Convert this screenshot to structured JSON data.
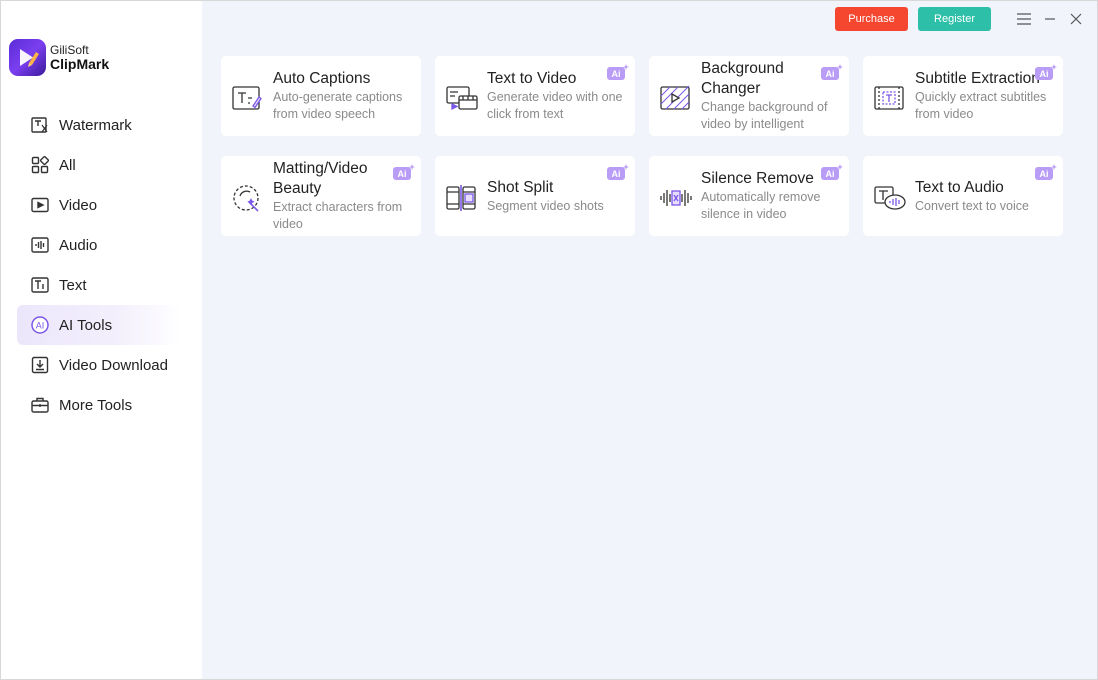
{
  "app": {
    "brand": "GiliSoft",
    "product": "ClipMark"
  },
  "topbar": {
    "purchase_label": "Purchase",
    "register_label": "Register"
  },
  "sidebar": {
    "items": [
      {
        "label": "Watermark",
        "icon": "watermark-icon",
        "active": false
      },
      {
        "label": "All",
        "icon": "grid-icon",
        "active": false
      },
      {
        "label": "Video",
        "icon": "video-icon",
        "active": false
      },
      {
        "label": "Audio",
        "icon": "audio-icon",
        "active": false
      },
      {
        "label": "Text",
        "icon": "text-icon",
        "active": false
      },
      {
        "label": "AI Tools",
        "icon": "ai-icon",
        "active": true
      },
      {
        "label": "Video Download",
        "icon": "download-icon",
        "active": false
      },
      {
        "label": "More Tools",
        "icon": "toolbox-icon",
        "active": false
      }
    ]
  },
  "tools": [
    {
      "title": "Auto Captions",
      "desc": "Auto-generate captions from video speech",
      "ai": false,
      "icon": "auto-captions-icon"
    },
    {
      "title": "Text to Video",
      "desc": "Generate video with one click from text",
      "ai": true,
      "icon": "text-to-video-icon"
    },
    {
      "title": "Background Changer",
      "desc": "Change background of video by intelligent",
      "ai": true,
      "icon": "background-changer-icon"
    },
    {
      "title": "Subtitle Extraction",
      "desc": "Quickly extract subtitles from video",
      "ai": true,
      "icon": "subtitle-extraction-icon"
    },
    {
      "title": "Matting/Video Beauty",
      "desc": "Extract characters from video",
      "ai": true,
      "icon": "matting-icon"
    },
    {
      "title": "Shot Split",
      "desc": "Segment video shots",
      "ai": true,
      "icon": "shot-split-icon"
    },
    {
      "title": "Silence Remove",
      "desc": "Automatically remove silence in video",
      "ai": true,
      "icon": "silence-remove-icon"
    },
    {
      "title": "Text to Audio",
      "desc": "Convert text to voice",
      "ai": true,
      "icon": "text-to-audio-icon"
    }
  ],
  "colors": {
    "accent": "#7b57e8",
    "purchase": "#f5462f",
    "register": "#2ebfa8",
    "main_bg": "#f1f4fb"
  }
}
